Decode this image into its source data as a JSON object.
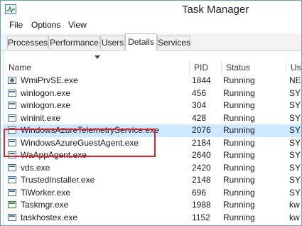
{
  "window": {
    "title": "Task Manager"
  },
  "menu": {
    "items": [
      "File",
      "Options",
      "View"
    ]
  },
  "tabs": [
    {
      "label": "Processes",
      "active": false
    },
    {
      "label": "Performance",
      "active": false
    },
    {
      "label": "Users",
      "active": false
    },
    {
      "label": "Details",
      "active": true
    },
    {
      "label": "Services",
      "active": false
    }
  ],
  "table": {
    "columns": [
      "Name",
      "PID",
      "Status",
      "Use"
    ],
    "rows": [
      {
        "icon": "gear-process-icon",
        "name": "WmiPrvSE.exe",
        "pid": "1844",
        "status": "Running",
        "user": "NE"
      },
      {
        "icon": "process-icon",
        "name": "winlogon.exe",
        "pid": "456",
        "status": "Running",
        "user": "SYS"
      },
      {
        "icon": "process-icon",
        "name": "winlogon.exe",
        "pid": "304",
        "status": "Running",
        "user": "SYS"
      },
      {
        "icon": "process-icon",
        "name": "wininit.exe",
        "pid": "428",
        "status": "Running",
        "user": "SYS"
      },
      {
        "icon": "process-icon",
        "name": "WindowsAzureTelemetryService.exe",
        "pid": "2076",
        "status": "Running",
        "user": "SYS",
        "selected": true
      },
      {
        "icon": "process-icon",
        "name": "WindowsAzureGuestAgent.exe",
        "pid": "2184",
        "status": "Running",
        "user": "SYS"
      },
      {
        "icon": "process-icon",
        "name": "WaAppAgent.exe",
        "pid": "2640",
        "status": "Running",
        "user": "SYS"
      },
      {
        "icon": "process-icon",
        "name": "vds.exe",
        "pid": "2420",
        "status": "Running",
        "user": "SYS"
      },
      {
        "icon": "process-icon",
        "name": "TrustedInstaller.exe",
        "pid": "2148",
        "status": "Running",
        "user": "SYS"
      },
      {
        "icon": "process-icon",
        "name": "TiWorker.exe",
        "pid": "696",
        "status": "Running",
        "user": "SYS"
      },
      {
        "icon": "taskmgr-icon",
        "name": "Taskmgr.exe",
        "pid": "1988",
        "status": "Running",
        "user": "kw"
      },
      {
        "icon": "process-icon",
        "name": "taskhostex.exe",
        "pid": "1152",
        "status": "Running",
        "user": "kw"
      }
    ]
  },
  "colors": {
    "selection": "#cde8ff",
    "highlight_box": "#e0202a",
    "accent": "#3f73a8"
  }
}
